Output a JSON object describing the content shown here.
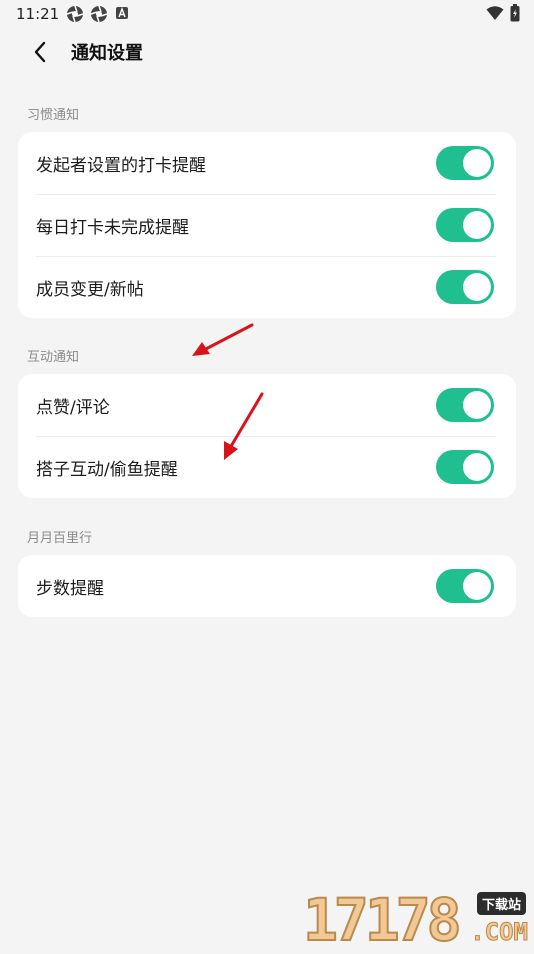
{
  "status_bar": {
    "time": "11:21",
    "left_icons": [
      "aperture-icon",
      "aperture-icon",
      "app-badge-icon"
    ],
    "right_icons": [
      "wifi-icon",
      "battery-icon"
    ]
  },
  "header": {
    "back_icon": "chevron-left-icon",
    "title": "通知设置"
  },
  "sections": [
    {
      "label": "习惯通知",
      "items": [
        {
          "label": "发起者设置的打卡提醒",
          "enabled": true
        },
        {
          "label": "每日打卡未完成提醒",
          "enabled": true
        },
        {
          "label": "成员变更/新帖",
          "enabled": true
        }
      ]
    },
    {
      "label": "互动通知",
      "items": [
        {
          "label": "点赞/评论",
          "enabled": true
        },
        {
          "label": "搭子互动/偷鱼提醒",
          "enabled": true
        }
      ]
    },
    {
      "label": "月月百里行",
      "items": [
        {
          "label": "步数提醒",
          "enabled": true
        }
      ]
    }
  ],
  "colors": {
    "toggle_on": "#1fbf8f",
    "background": "#f4f4f4",
    "annotation_arrow": "#d9131b"
  },
  "watermark": {
    "text": "17178",
    "tag": "下载站",
    "domain": ".COM"
  }
}
